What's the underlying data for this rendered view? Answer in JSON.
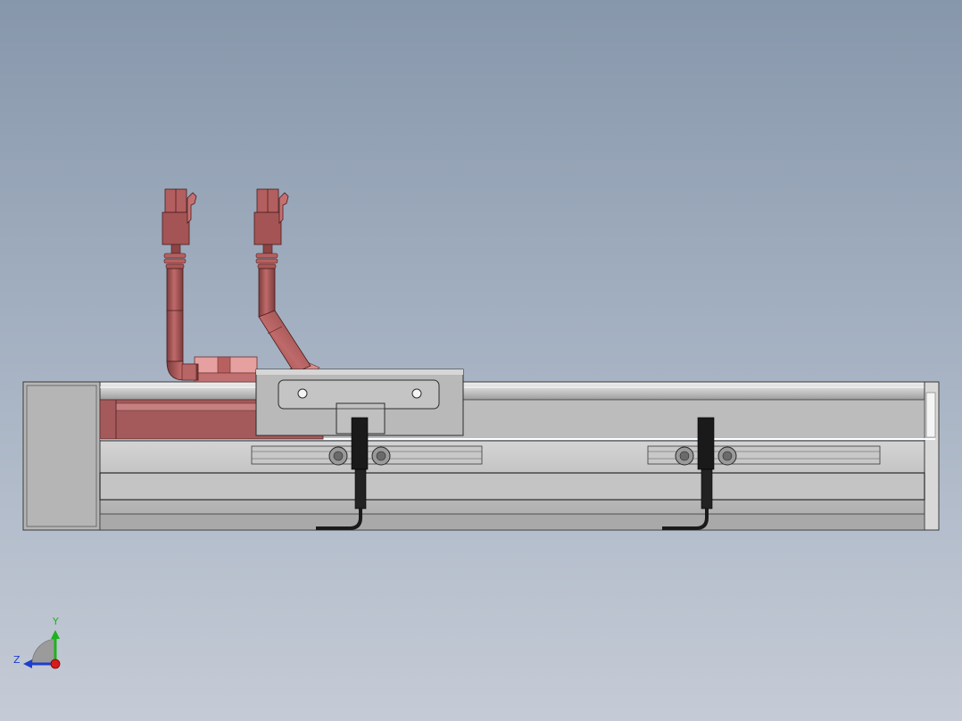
{
  "viewport": {
    "background_top": "#8797ab",
    "background_bottom": "#c5cbd6"
  },
  "model": {
    "body_color": "#c8c8c8",
    "pipe_color": "#a85a5a",
    "pipe_light": "#e8a0a0",
    "sensor_color": "#1a1a1a"
  },
  "triad": {
    "y_label": "Y",
    "z_label": "Z",
    "y_color": "#1db31d",
    "z_color": "#1e3ecc",
    "origin_color": "#d81c1c"
  }
}
